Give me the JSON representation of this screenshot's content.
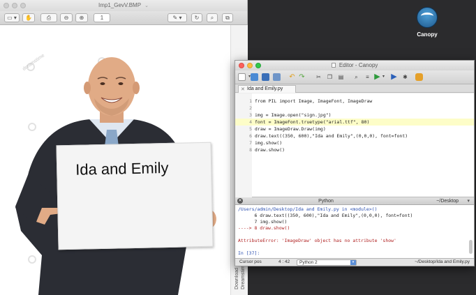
{
  "preview": {
    "window_title": "Imp1_GevV.BMP",
    "zoom_field": "1",
    "sign_text": "Ida and Emily",
    "watermark": "dreamstime",
    "side_text": "Download from Dreamstime"
  },
  "desktop": {
    "canopy_label": "Canopy"
  },
  "editor": {
    "window_title": "Editor - Canopy",
    "tab_label": "Ida and Emily.py",
    "code_lines": [
      {
        "num": "1",
        "text": "from PIL import Image, ImageFont, ImageDraw"
      },
      {
        "num": "2",
        "text": ""
      },
      {
        "num": "3",
        "text": "img = Image.open(\"sign.jpg\")"
      },
      {
        "num": "4",
        "text": "font = ImageFont.truetype(\"arial.ttf\", 80)"
      },
      {
        "num": "5",
        "text": "draw = ImageDraw.Draw(img)"
      },
      {
        "num": "6",
        "text": "draw.text((350, 600),\"Ida and Emily\",(0,0,0), font=font)"
      },
      {
        "num": "7",
        "text": "img.show()"
      },
      {
        "num": "8",
        "text": "draw.show()"
      }
    ],
    "highlighted_line": 4
  },
  "python_panel": {
    "title": "Python",
    "path": "~/Desktop",
    "console_lines": [
      "/Users/admin/Desktop/Ida and Emily.py in <module>()",
      "      6 draw.text((350, 600),\"Ida and Emily\",(0,0,0), font=font)",
      "      7 img.show()",
      "----> 8 draw.show()",
      "",
      "AttributeError: 'ImageDraw' object has no attribute 'show'",
      "",
      "In [37]:"
    ]
  },
  "status_bar": {
    "cursor_label": "Cursor pos",
    "cursor_value": "4 : 42",
    "interpreter": "Python 2",
    "file_path": "~/Desktop/Ida and Emily.py"
  }
}
